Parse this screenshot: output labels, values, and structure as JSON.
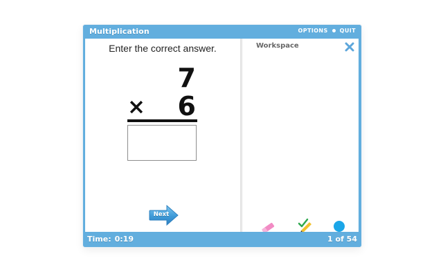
{
  "app": {
    "title": "Multiplication",
    "options_label": "OPTIONS",
    "quit_label": "QUIT"
  },
  "problem": {
    "instruction": "Enter the correct answer.",
    "top_number": "7",
    "operator": "×",
    "bottom_number": "6",
    "answer_value": ""
  },
  "actions": {
    "next_label": "Next"
  },
  "workspace": {
    "title": "Workspace",
    "close_label": "X",
    "tools": [
      {
        "name": "eraser-icon",
        "color": "#f18bc3"
      },
      {
        "name": "pencil-check-icon",
        "color": "#f2c12e"
      },
      {
        "name": "color-dot-icon",
        "color": "#1ba6e8"
      }
    ]
  },
  "status": {
    "time_label": "Time:",
    "time_value": "0:19",
    "progress": "1 of 54"
  },
  "colors": {
    "accent": "#62aede",
    "text": "#111111"
  }
}
